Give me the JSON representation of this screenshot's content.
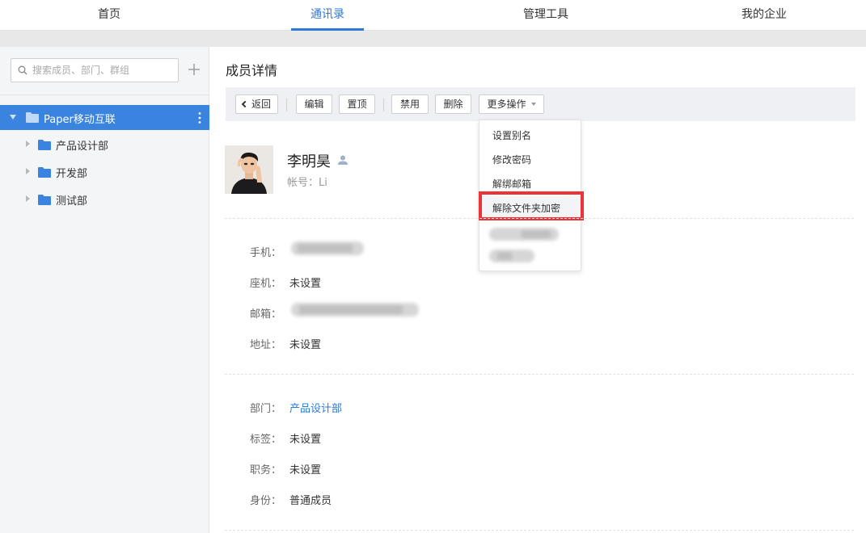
{
  "nav": {
    "tabs": [
      {
        "label": "首页"
      },
      {
        "label": "通讯录"
      },
      {
        "label": "管理工具"
      },
      {
        "label": "我的企业"
      }
    ],
    "active_index": 1
  },
  "sidebar": {
    "search_placeholder": "搜索成员、部门、群组",
    "root": {
      "label": "Paper移动互联"
    },
    "departments": [
      {
        "label": "产品设计部"
      },
      {
        "label": "开发部"
      },
      {
        "label": "测试部"
      }
    ]
  },
  "main": {
    "title": "成员详情",
    "toolbar": {
      "back": "返回",
      "edit": "编辑",
      "pin": "置顶",
      "disable": "禁用",
      "delete": "删除",
      "more": "更多操作"
    },
    "more_menu": {
      "items": [
        {
          "label": "设置别名"
        },
        {
          "label": "修改密码"
        },
        {
          "label": "解绑邮箱"
        },
        {
          "label": "解除文件夹加密"
        }
      ]
    },
    "member": {
      "name": "李明昊",
      "account": "帐号：Li"
    },
    "contact": {
      "phone_label": "手机：",
      "landline_label": "座机：",
      "landline_value": "未设置",
      "email_label": "邮箱：",
      "address_label": "地址：",
      "address_value": "未设置"
    },
    "org": {
      "department_label": "部门：",
      "department_value": "产品设计部",
      "tags_label": "标签：",
      "tags_value": "未设置",
      "position_label": "职务：",
      "position_value": "未设置",
      "identity_label": "身份：",
      "identity_value": "普通成员"
    }
  },
  "colors": {
    "accent": "#2d7ad6",
    "sidebar_selected": "#3a84e0",
    "highlight_border": "#ee3338"
  }
}
